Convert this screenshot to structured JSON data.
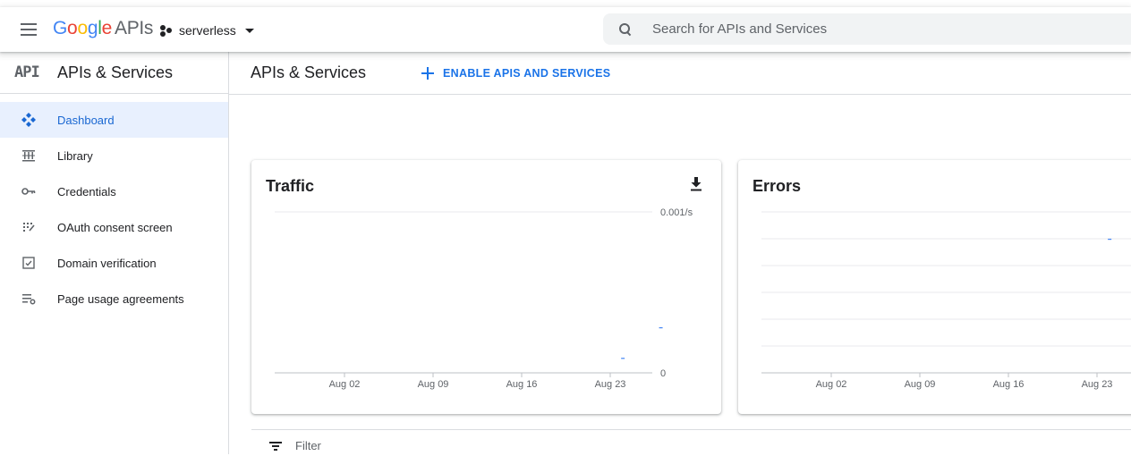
{
  "header": {
    "logo_letters": [
      "G",
      "o",
      "o",
      "g",
      "l",
      "e"
    ],
    "logo_suffix": "APIs",
    "project_name": "serverless",
    "search_placeholder": "Search for APIs and Services"
  },
  "sidebar": {
    "badge": "API",
    "title": "APIs & Services",
    "items": [
      {
        "label": "Dashboard",
        "icon": "dashboard-icon",
        "active": true
      },
      {
        "label": "Library",
        "icon": "library-icon",
        "active": false
      },
      {
        "label": "Credentials",
        "icon": "key-icon",
        "active": false
      },
      {
        "label": "OAuth consent screen",
        "icon": "oauth-consent-icon",
        "active": false
      },
      {
        "label": "Domain verification",
        "icon": "domain-verification-icon",
        "active": false
      },
      {
        "label": "Page usage agreements",
        "icon": "page-usage-icon",
        "active": false
      }
    ]
  },
  "main": {
    "title": "APIs & Services",
    "enable_button": "ENABLE APIS AND SERVICES",
    "filter_placeholder": "Filter"
  },
  "colors": {
    "accent": "#1a73e8",
    "active_bg": "#e8f0fe",
    "series": "#4285f4"
  },
  "chart_data": [
    {
      "type": "line",
      "title": "Traffic",
      "x_ticks": [
        "Aug 02",
        "Aug 09",
        "Aug 16",
        "Aug 23"
      ],
      "y_ticks": [
        "0.001/s",
        "0"
      ],
      "ylim": [
        0,
        0.001
      ],
      "series": [
        {
          "points": [
            {
              "x": "Aug 24",
              "y": 9e-05
            },
            {
              "x": "Aug 27",
              "y": 0.00028
            }
          ]
        }
      ],
      "grid": true
    },
    {
      "type": "line",
      "title": "Errors",
      "x_ticks": [
        "Aug 02",
        "Aug 09",
        "Aug 16",
        "Aug 23"
      ],
      "y_ticks": [],
      "series": [
        {
          "points": [
            {
              "x": "Aug 24",
              "y": 0.83
            }
          ]
        }
      ],
      "grid": true
    }
  ]
}
